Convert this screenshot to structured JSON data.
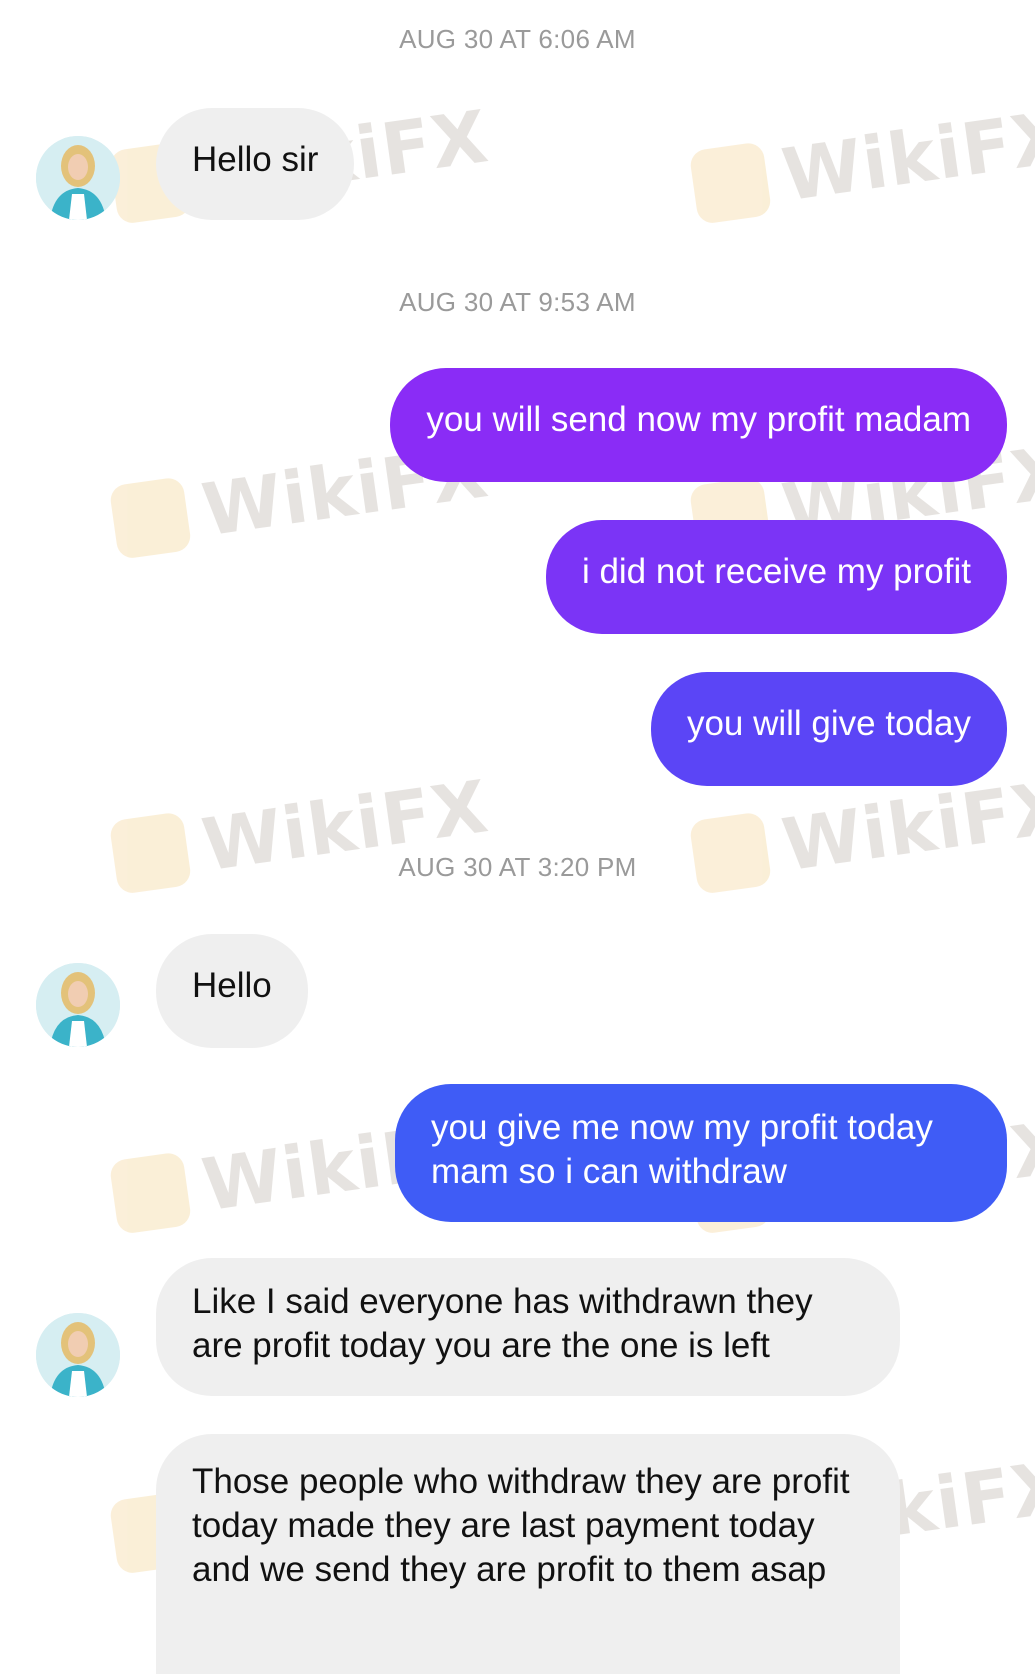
{
  "watermark": {
    "text": "WikiFX",
    "badge_color": "#e8a92a"
  },
  "colors": {
    "incoming_bubble": "#efefef",
    "outgoing_1": "#8a2cf6",
    "outgoing_2": "#7b34f6",
    "outgoing_3": "#5b45f6",
    "outgoing_4": "#3f5cf6",
    "timestamp": "#9a9a9a"
  },
  "conversation": {
    "timestamps": [
      "AUG 30 AT 6:06 AM",
      "AUG 30 AT 9:53 AM",
      "AUG 30 AT 3:20 PM"
    ],
    "messages": [
      {
        "from": "incoming",
        "text": "Hello sir"
      },
      {
        "from": "outgoing",
        "text": "you will send now my profit madam"
      },
      {
        "from": "outgoing",
        "text": "i did not receive my profit"
      },
      {
        "from": "outgoing",
        "text": "you will give today"
      },
      {
        "from": "incoming",
        "text": "Hello"
      },
      {
        "from": "outgoing",
        "text": "you give me now my profit today mam so i can withdraw"
      },
      {
        "from": "incoming",
        "text": "Like I said everyone has withdrawn they are profit today you are the one is left"
      },
      {
        "from": "incoming",
        "text": "Those people who withdraw they are profit today made they are last payment today and we send they are profit to them asap"
      }
    ]
  }
}
